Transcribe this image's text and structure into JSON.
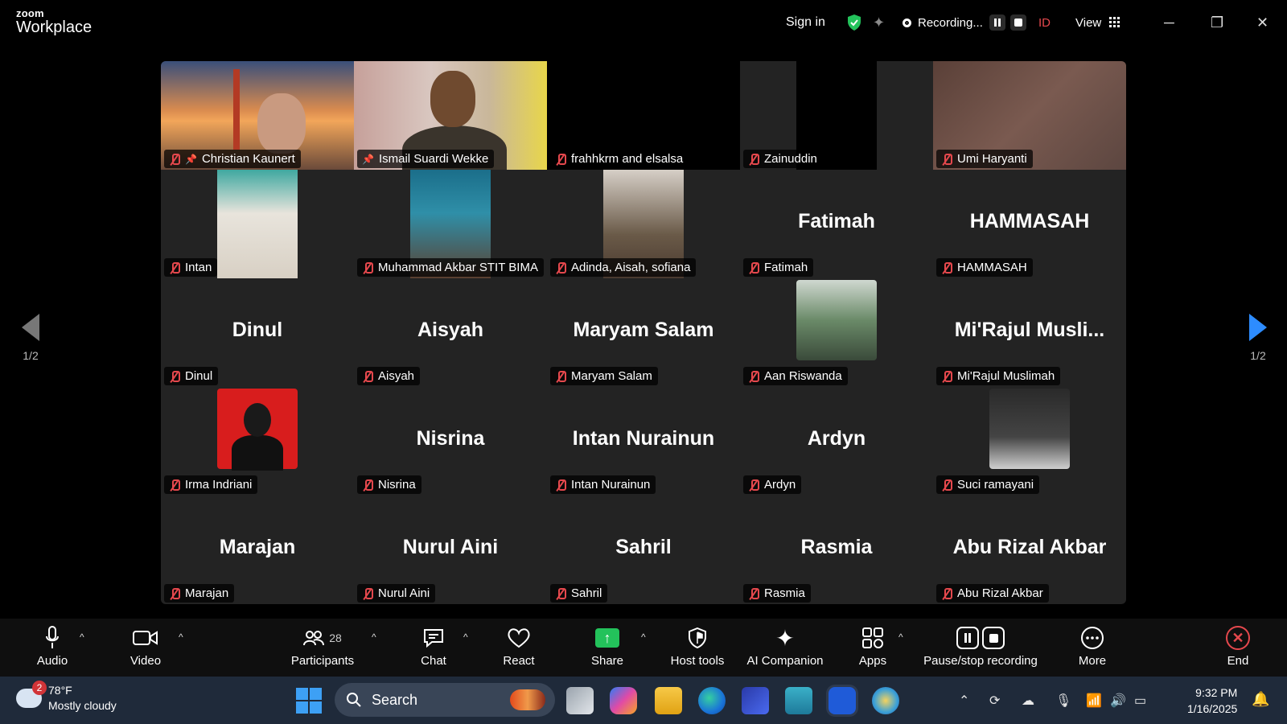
{
  "titlebar": {
    "logo_small": "zoom",
    "logo_big": "Workplace",
    "sign_in": "Sign in",
    "recording": "Recording...",
    "id_label": "ID",
    "view": "View",
    "minimize": "─",
    "restore": "❐",
    "close": "✕"
  },
  "pager": {
    "left_page": "1/2",
    "right_page": "1/2"
  },
  "participants": [
    {
      "name": "Christian Kaunert",
      "display": "",
      "pinned": true
    },
    {
      "name": "Ismail Suardi Wekke",
      "display": "",
      "pinned": true
    },
    {
      "name": "frahhkrm and elsalsa",
      "display": ""
    },
    {
      "name": "Zainuddin",
      "display": ""
    },
    {
      "name": "Umi Haryanti",
      "display": ""
    },
    {
      "name": "Intan",
      "display": ""
    },
    {
      "name": "Muhammad Akbar STIT BIMA",
      "display": ""
    },
    {
      "name": "Adinda, Aisah, sofiana",
      "display": ""
    },
    {
      "name": "Fatimah",
      "display": "Fatimah"
    },
    {
      "name": "HAMMASAH",
      "display": "HAMMASAH"
    },
    {
      "name": "Dinul",
      "display": "Dinul"
    },
    {
      "name": "Aisyah",
      "display": "Aisyah"
    },
    {
      "name": "Maryam Salam",
      "display": "Maryam Salam"
    },
    {
      "name": "Aan Riswanda",
      "display": ""
    },
    {
      "name": "Mi'Rajul Muslimah",
      "display": "Mi'Rajul Musli..."
    },
    {
      "name": "Irma Indriani",
      "display": ""
    },
    {
      "name": "Nisrina",
      "display": "Nisrina"
    },
    {
      "name": "Intan Nurainun",
      "display": "Intan Nurainun"
    },
    {
      "name": "Ardyn",
      "display": "Ardyn"
    },
    {
      "name": "Suci ramayani",
      "display": ""
    },
    {
      "name": "Marajan",
      "display": "Marajan"
    },
    {
      "name": "Nurul Aini",
      "display": "Nurul Aini"
    },
    {
      "name": "Sahril",
      "display": "Sahril"
    },
    {
      "name": "Rasmia",
      "display": "Rasmia"
    },
    {
      "name": "Abu Rizal Akbar",
      "display": "Abu Rizal Akbar"
    }
  ],
  "toolbar": {
    "audio": "Audio",
    "video": "Video",
    "participants": "Participants",
    "participants_count": "28",
    "chat": "Chat",
    "react": "React",
    "share": "Share",
    "host_tools": "Host tools",
    "ai_companion": "AI Companion",
    "apps": "Apps",
    "pause_stop": "Pause/stop recording",
    "more": "More",
    "end": "End"
  },
  "taskbar": {
    "weather_temp": "78°F",
    "weather_desc": "Mostly cloudy",
    "weather_badge": "2",
    "search": "Search",
    "time": "9:32 PM",
    "date": "1/16/2025"
  },
  "colors": {
    "accent_blue": "#2d8cff",
    "active_speaker": "#23d160",
    "mute_red": "#e5484d",
    "share_green": "#23c25b"
  }
}
